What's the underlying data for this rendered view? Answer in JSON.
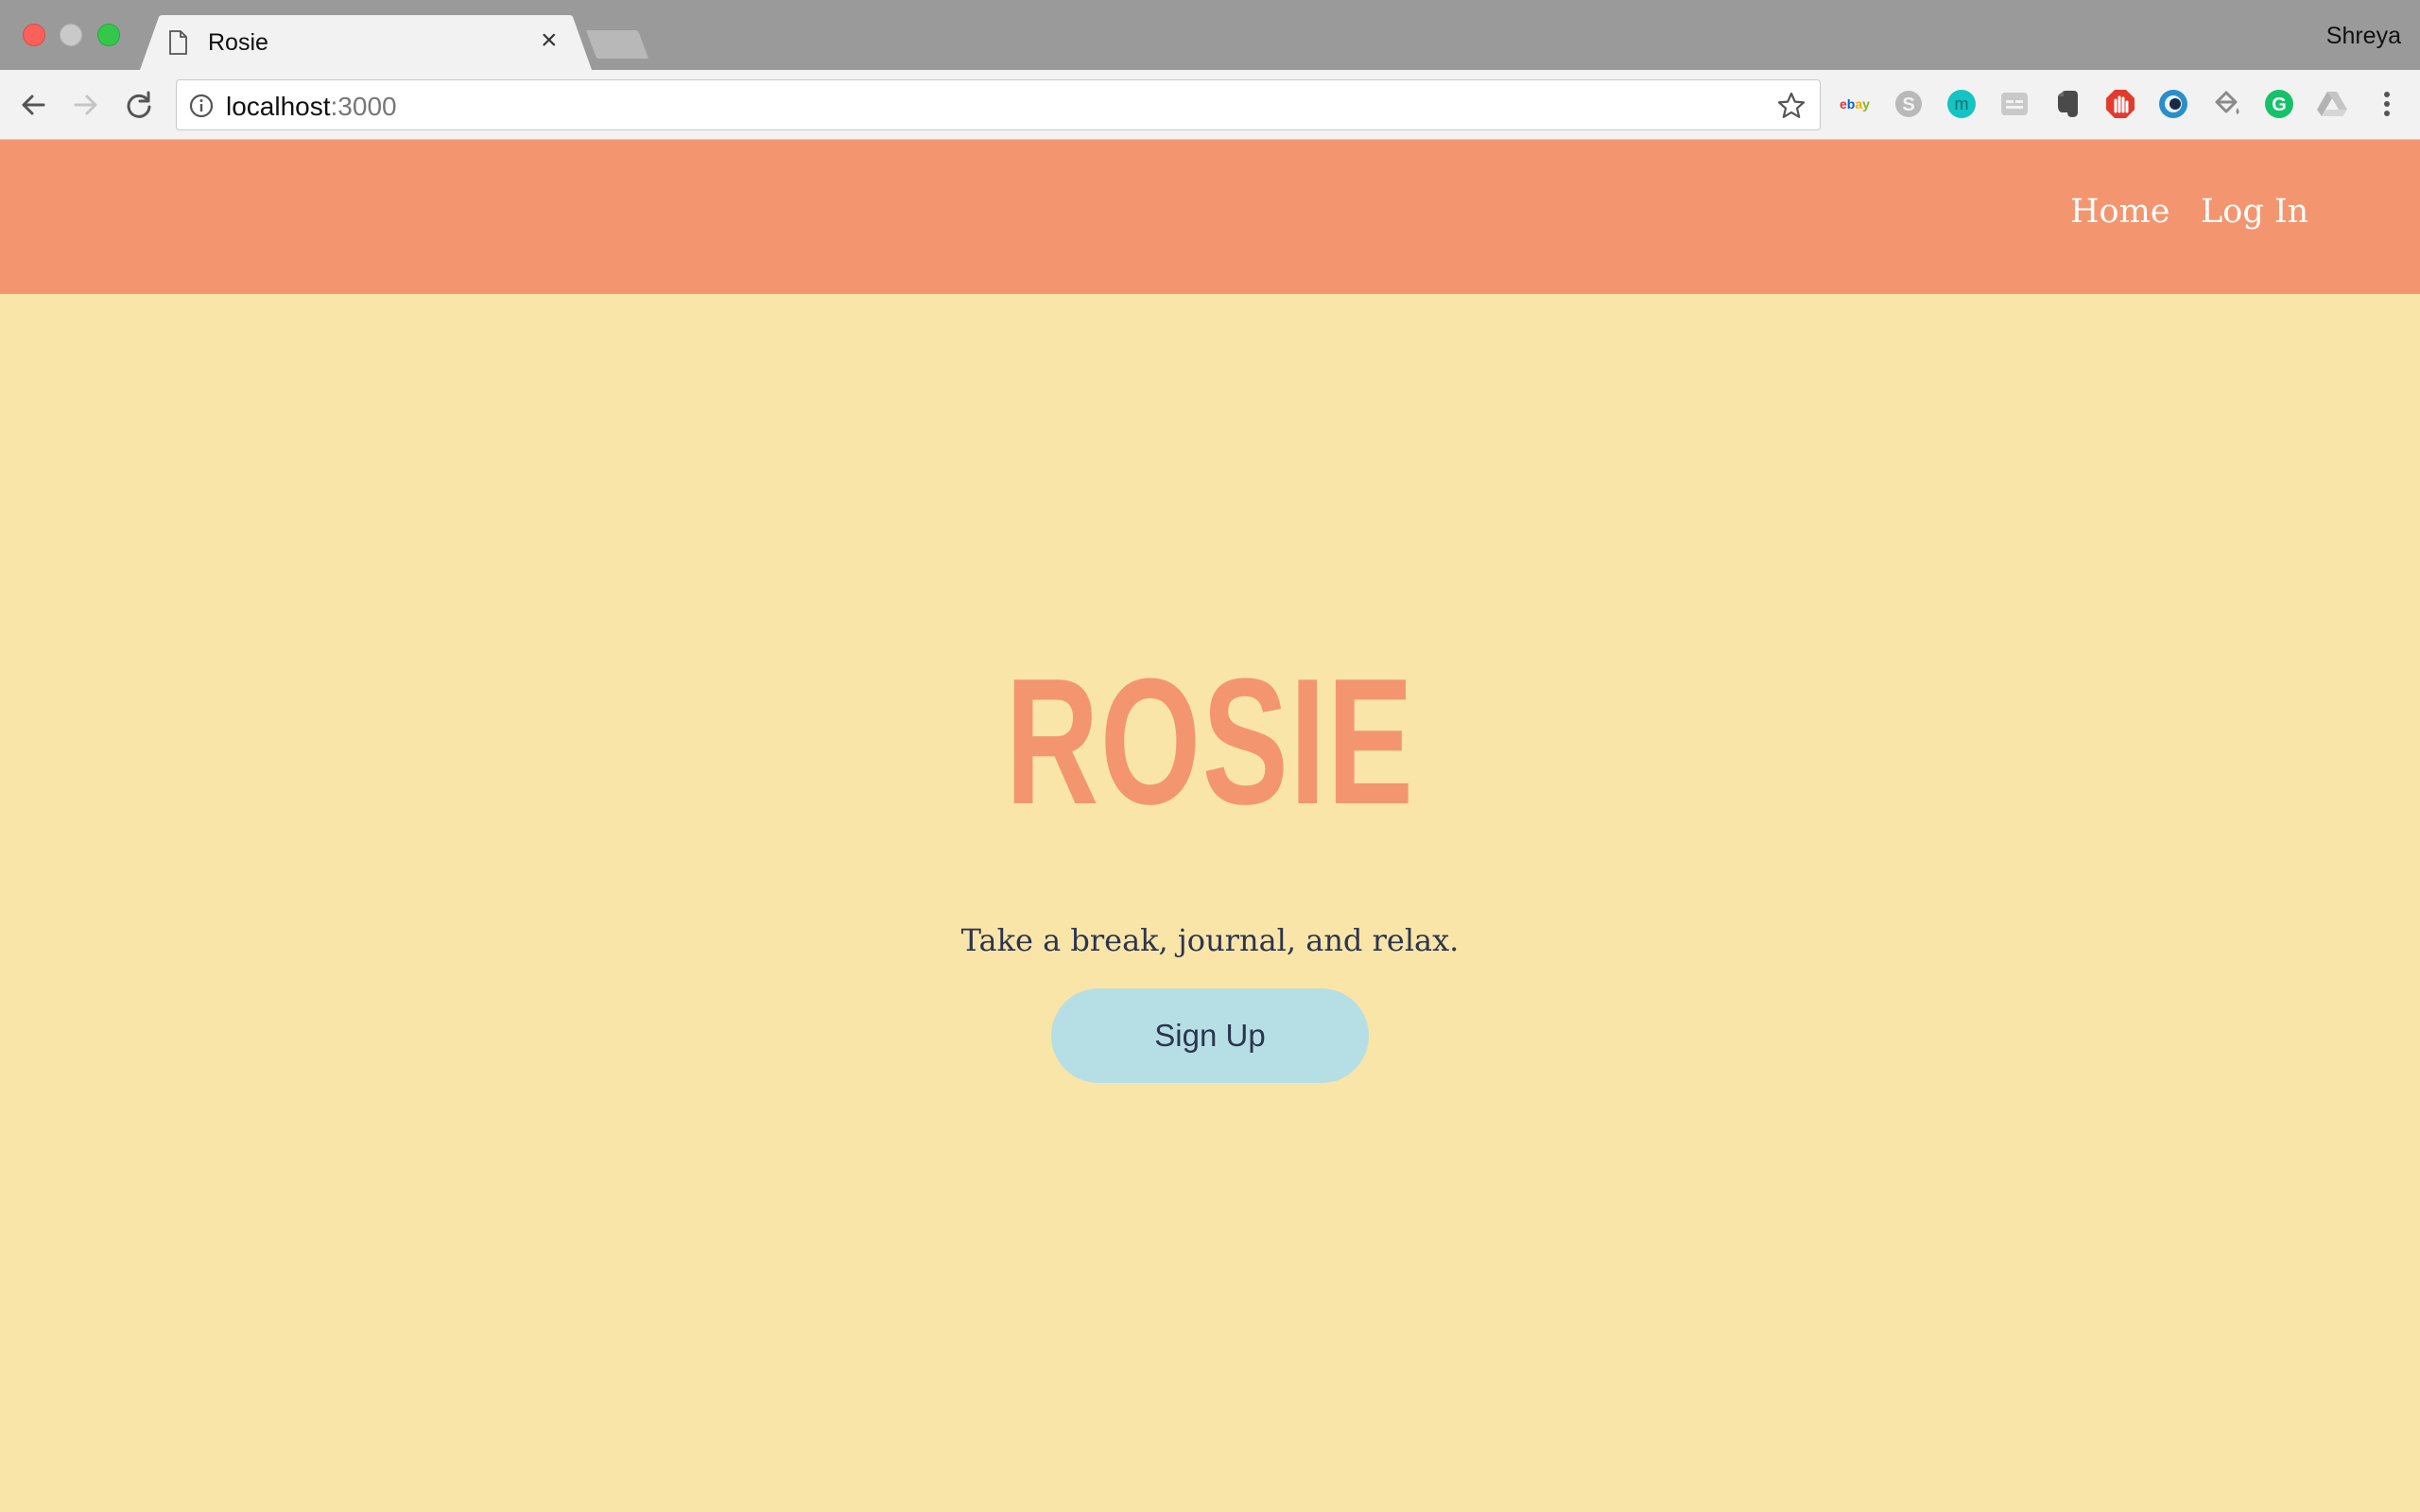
{
  "browser": {
    "tab_title": "Rosie",
    "tab_close_glyph": "×",
    "profile_name": "Shreya",
    "url_host": "localhost",
    "url_port": ":3000",
    "icons": {
      "tab": "document-icon",
      "back": "back-arrow-icon",
      "forward": "forward-arrow-icon",
      "reload": "reload-icon",
      "info": "info-icon",
      "bookmark": "star-icon",
      "menu": "more-vert-icon"
    },
    "extensions": [
      "ebay-icon",
      "skype-icon",
      "m-extension-icon",
      "reader-icon",
      "evernote-icon",
      "adblock-icon",
      "eye-icon",
      "paint-bucket-icon",
      "grammarly-icon",
      "drive-icon"
    ]
  },
  "site": {
    "nav": {
      "home": "Home",
      "login": "Log In"
    },
    "title": "ROSIE",
    "tagline": "Take a break, journal, and relax.",
    "signup": "Sign Up"
  },
  "colors": {
    "header": "#f39670",
    "background": "#f9e5a8",
    "title": "#f39670",
    "text": "#2c3550",
    "button": "#b5dfe5"
  }
}
